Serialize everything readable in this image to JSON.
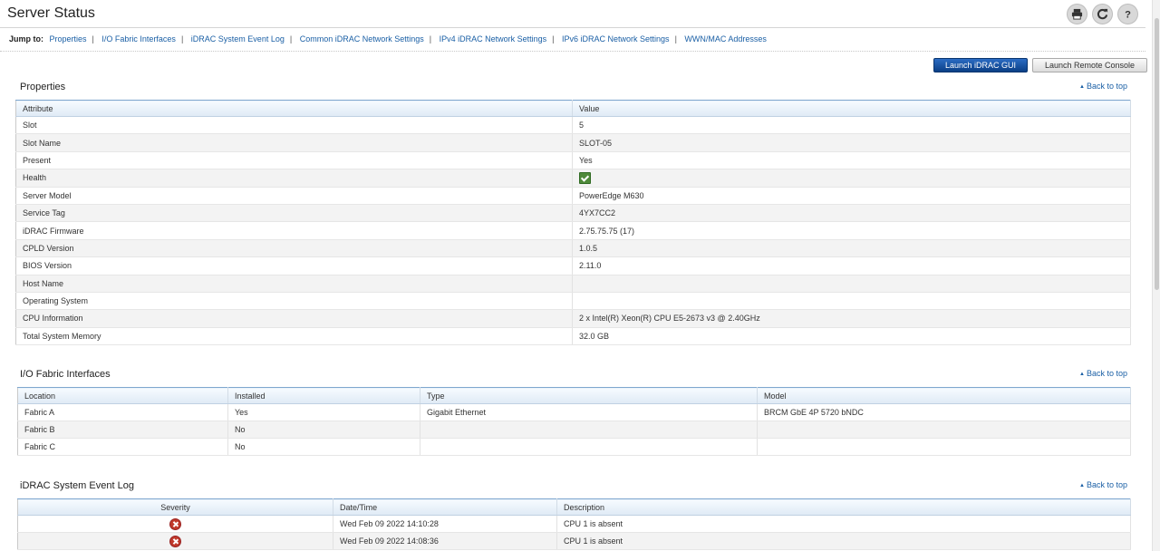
{
  "page": {
    "title": "Server Status"
  },
  "toolbar": {
    "icons": [
      "print-icon",
      "refresh-icon",
      "help-icon"
    ]
  },
  "jumpbar": {
    "label": "Jump to:",
    "links": [
      "Properties",
      "I/O Fabric Interfaces",
      "iDRAC System Event Log",
      "Common iDRAC Network Settings",
      "IPv4 iDRAC Network Settings",
      "IPv6 iDRAC Network Settings",
      "WWN/MAC Addresses"
    ],
    "separator": "|"
  },
  "buttons": {
    "launch_idrac": "Launch iDRAC GUI",
    "launch_console": "Launch Remote Console"
  },
  "back_to_top": "Back to top",
  "properties": {
    "title": "Properties",
    "headers": [
      "Attribute",
      "Value"
    ],
    "rows": [
      [
        "Slot",
        "5"
      ],
      [
        "Slot Name",
        "SLOT-05"
      ],
      [
        "Present",
        "Yes"
      ],
      [
        "Health",
        ""
      ],
      [
        "Server Model",
        "PowerEdge M630"
      ],
      [
        "Service Tag",
        "4YX7CC2"
      ],
      [
        "iDRAC Firmware",
        "2.75.75.75 (17)"
      ],
      [
        "CPLD Version",
        "1.0.5"
      ],
      [
        "BIOS Version",
        "2.11.0"
      ],
      [
        "Host Name",
        ""
      ],
      [
        "Operating System",
        ""
      ],
      [
        "CPU Information",
        "2 x Intel(R) Xeon(R) CPU E5-2673 v3 @ 2.40GHz"
      ],
      [
        "Total System Memory",
        "32.0  GB"
      ]
    ],
    "health_icon": "ok-check-icon"
  },
  "io_fabric": {
    "title": "I/O Fabric Interfaces",
    "headers": [
      "Location",
      "Installed",
      "Type",
      "Model"
    ],
    "rows": [
      [
        "Fabric  A",
        "Yes",
        "Gigabit Ethernet",
        "BRCM GbE 4P 5720 bNDC"
      ],
      [
        "Fabric  B",
        "No",
        "",
        ""
      ],
      [
        "Fabric  C",
        "No",
        "",
        ""
      ]
    ]
  },
  "event_log": {
    "title": "iDRAC System Event Log",
    "headers": [
      "Severity",
      "Date/Time",
      "Description"
    ],
    "rows": [
      [
        "critical",
        "Wed Feb 09 2022 14:10:28",
        "CPU 1 is absent"
      ],
      [
        "critical",
        "Wed Feb 09 2022 14:08:36",
        "CPU 1 is absent"
      ]
    ]
  },
  "colors": {
    "link": "#1a5fa5",
    "primary_button": "#0b3f86",
    "ok": "#4f8a3a",
    "critical": "#c0392b"
  }
}
